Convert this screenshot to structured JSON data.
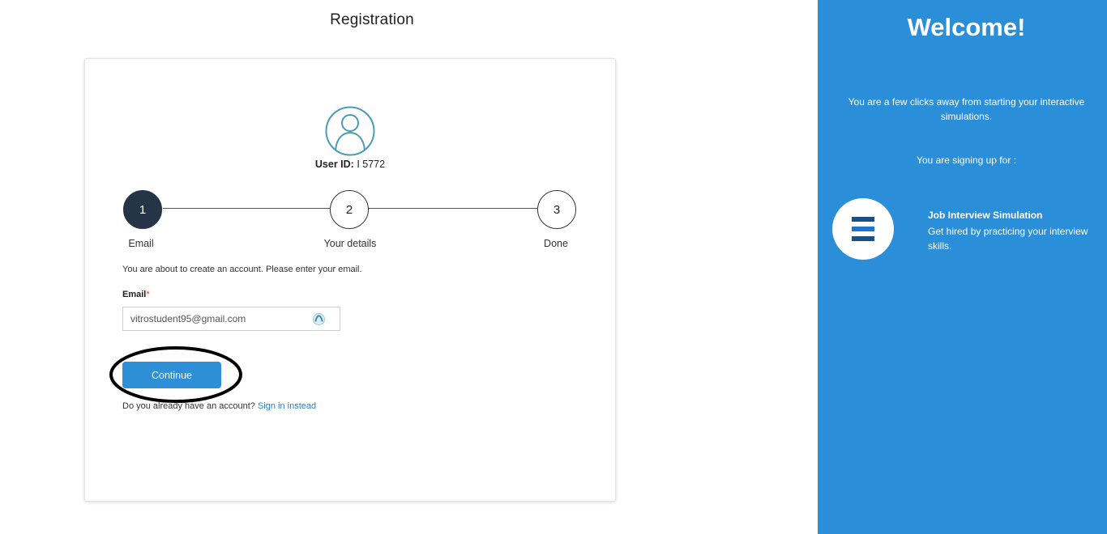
{
  "page": {
    "title": "Registration"
  },
  "profile": {
    "user_id_label": "User ID:",
    "user_id_value": "I 5772"
  },
  "stepper": {
    "steps": [
      {
        "number": "1",
        "label": "Email",
        "state": "active"
      },
      {
        "number": "2",
        "label": "Your details",
        "state": "pending"
      },
      {
        "number": "3",
        "label": "Done",
        "state": "pending"
      }
    ]
  },
  "form": {
    "intro": "You are about to create an account. Please enter your email.",
    "email_label": "Email",
    "required_mark": "*",
    "email_value": "vitrostudent95@gmail.com",
    "continue_label": "Continue",
    "signin_prompt": "Do you already have an account?",
    "signin_link": "Sign in instead"
  },
  "welcome": {
    "title": "Welcome!",
    "subtitle": "You are a few clicks away from starting your interactive simulations.",
    "signing_up_for": "You are signing up for :",
    "simulation": {
      "title": "Job Interview Simulation",
      "description": "Get hired by practicing your interview skills."
    }
  },
  "colors": {
    "panel_blue": "#2a8fd8",
    "button_blue": "#2d8fd5",
    "active_step": "#263448",
    "avatar_teal": "#4a9bb4",
    "link_blue": "#2d7fc0"
  },
  "icons": [
    "user-avatar-icon",
    "email-field-status-icon",
    "simulation-logo-icon",
    "text-cursor-icon"
  ]
}
